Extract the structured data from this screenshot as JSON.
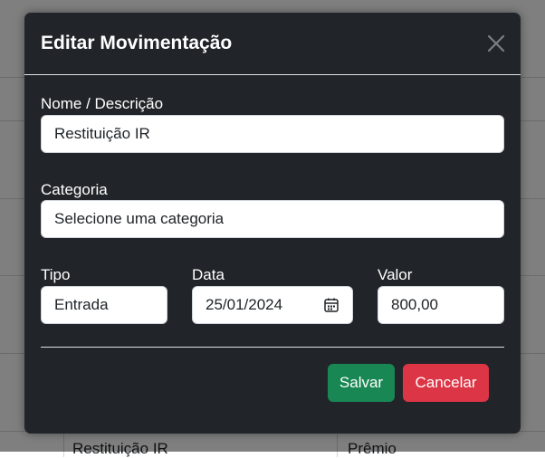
{
  "background": {
    "row_name": "Restituição IR",
    "row_category": "Prêmio"
  },
  "modal": {
    "title": "Editar Movimentação",
    "close_icon": "close-icon",
    "fields": {
      "name": {
        "label": "Nome / Descrição",
        "value": "Restituição IR"
      },
      "category": {
        "label": "Categoria",
        "value": "Selecione uma categoria"
      },
      "type": {
        "label": "Tipo",
        "value": "Entrada"
      },
      "date": {
        "label": "Data",
        "value": "25/01/2024",
        "icon": "calendar-icon"
      },
      "amount": {
        "label": "Valor",
        "value": "800,00"
      }
    },
    "buttons": {
      "save": "Salvar",
      "cancel": "Cancelar"
    }
  },
  "colors": {
    "modal_bg": "#212529",
    "save": "#198754",
    "cancel": "#dc3545"
  }
}
